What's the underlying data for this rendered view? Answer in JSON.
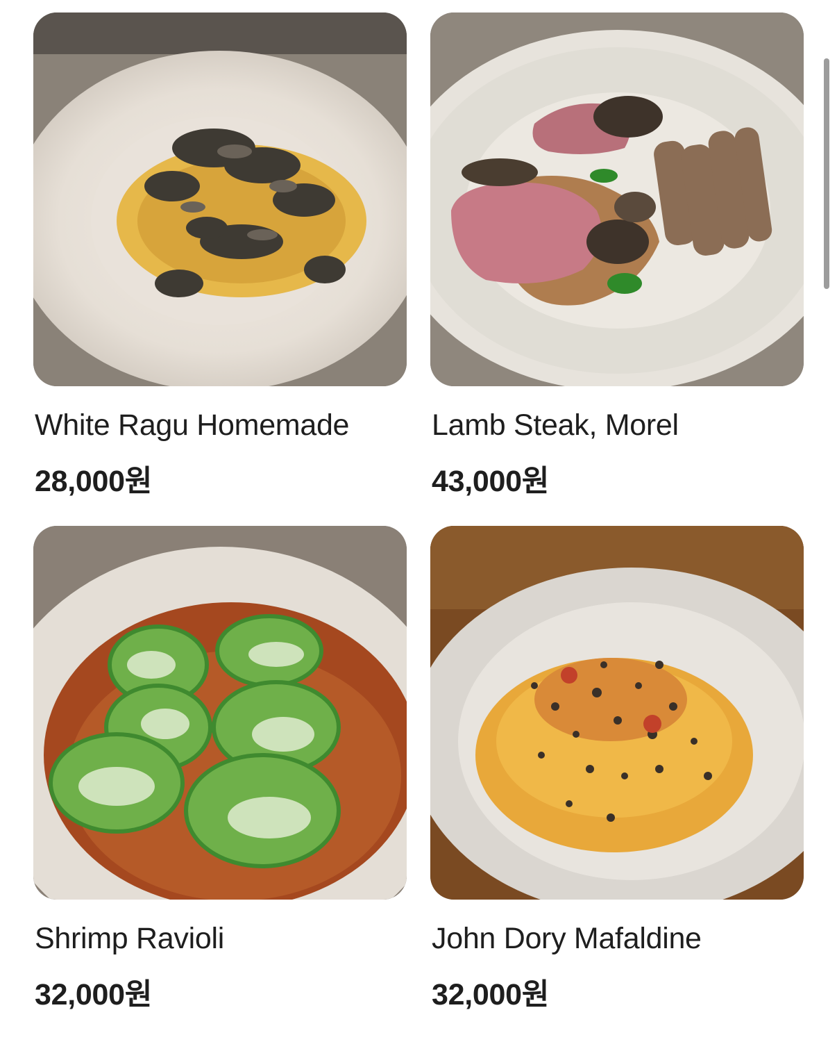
{
  "menu": {
    "items": [
      {
        "name": "White Ragu Homemade",
        "price": "28,000원",
        "image": "truffle-pasta-photo"
      },
      {
        "name": "Lamb Steak, Morel",
        "price": "43,000원",
        "image": "lamb-steak-photo"
      },
      {
        "name": "Shrimp Ravioli",
        "price": "32,000원",
        "image": "green-ravioli-photo"
      },
      {
        "name": "John Dory Mafaldine",
        "price": "32,000원",
        "image": "mafaldine-pasta-photo"
      }
    ]
  },
  "colors": {
    "text": "#1e1e1e",
    "background": "#ffffff",
    "scrollbar": "#9c9c9c"
  }
}
